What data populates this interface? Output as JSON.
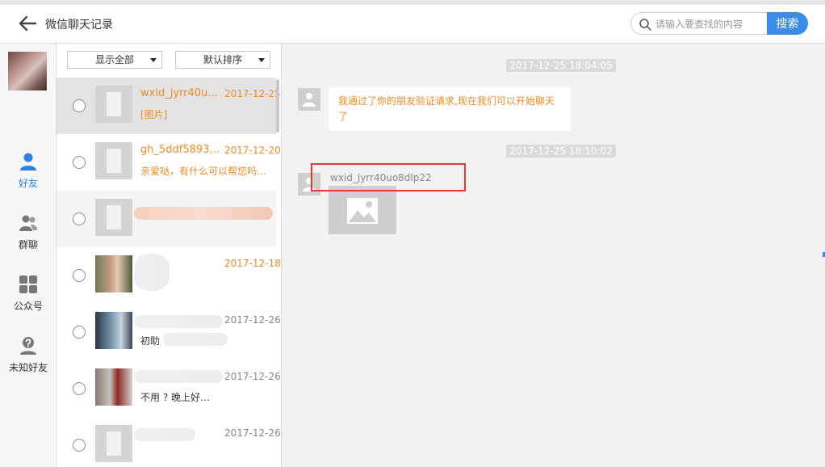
{
  "header": {
    "title": "微信聊天记录",
    "search_placeholder": "请输入要查找的内容",
    "search_button": "搜索"
  },
  "nav": {
    "items": [
      {
        "label": "好友",
        "icon": "person-icon",
        "active": true
      },
      {
        "label": "群聊",
        "icon": "group-icon",
        "active": false
      },
      {
        "label": "公众号",
        "icon": "grid-icon",
        "active": false
      },
      {
        "label": "未知好友",
        "icon": "unknown-person-icon",
        "active": false
      }
    ]
  },
  "filters": {
    "show": "显示全部",
    "sort": "默认排序"
  },
  "contacts": [
    {
      "name": "wxid_jyrr40uo…",
      "date": "2017-12-25",
      "preview": "[图片]",
      "selected": true
    },
    {
      "name": "gh_5ddf5893f…",
      "date": "2017-12-20",
      "preview": "亲爱哒，有什么可以帮您吗~…"
    },
    {
      "name": "",
      "date": "",
      "preview": ""
    },
    {
      "name": "",
      "date": "2017-12-18",
      "preview": ""
    },
    {
      "name": "",
      "date": "2017-12-26",
      "preview": "初助"
    },
    {
      "name": "",
      "date": "2017-12-26",
      "preview": "不用 ? 晚上好…"
    },
    {
      "name": "",
      "date": "2017-12-26",
      "preview": ""
    }
  ],
  "chat": {
    "timestamps": [
      "2017-12-25 18:04:05",
      "2017-12-25 18:10:02"
    ],
    "messages": [
      {
        "text": "我通过了你的朋友验证请求,现在我们可以开始聊天了"
      },
      {
        "sender": "wxid_jyrr40uo8dlp22",
        "type": "image"
      }
    ]
  },
  "colors": {
    "accent": "#3c8ce7",
    "highlight_text": "#f08a24",
    "annotation": "#e53935"
  }
}
